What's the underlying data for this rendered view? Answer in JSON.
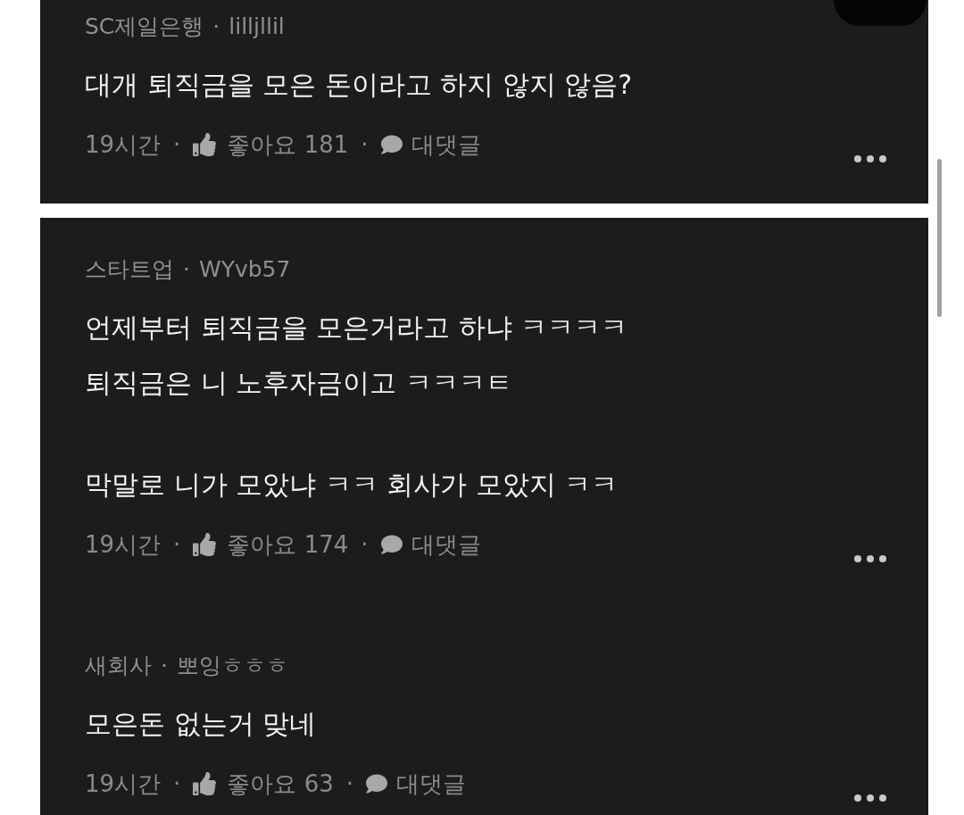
{
  "cards": [
    {
      "comments": [
        {
          "company": "SC제일은행",
          "separator": "·",
          "nickname": "lilljllil",
          "paragraphs": [
            [
              "대개 퇴직금을 모은 돈이라고 하지 않지 않음?"
            ]
          ],
          "time": "19시간",
          "footer_separators": [
            "·",
            "·"
          ],
          "like": {
            "label": "좋아요",
            "count": "181"
          },
          "reply": "대댓글"
        }
      ]
    },
    {
      "comments": [
        {
          "company": "스타트업",
          "separator": "·",
          "nickname": "WYvb57",
          "paragraphs": [
            [
              "언제부터 퇴직금을 모은거라고 하냐 ㅋㅋㅋㅋ",
              "퇴직금은 니 노후자금이고 ㅋㅋㅋㅌ"
            ],
            [
              "막말로 니가 모았냐 ㅋㅋ 회사가 모았지 ㅋㅋ"
            ]
          ],
          "time": "19시간",
          "footer_separators": [
            "·",
            "·"
          ],
          "like": {
            "label": "좋아요",
            "count": "174"
          },
          "reply": "대댓글"
        },
        {
          "company": "새회사",
          "separator": "·",
          "nickname": "뽀잉ㅎㅎㅎ",
          "paragraphs": [
            [
              "모은돈 없는거 맞네"
            ]
          ],
          "time": "19시간",
          "footer_separators": [
            "·",
            "·"
          ],
          "like": {
            "label": "좋아요",
            "count": "63"
          },
          "reply": "대댓글"
        }
      ]
    }
  ]
}
